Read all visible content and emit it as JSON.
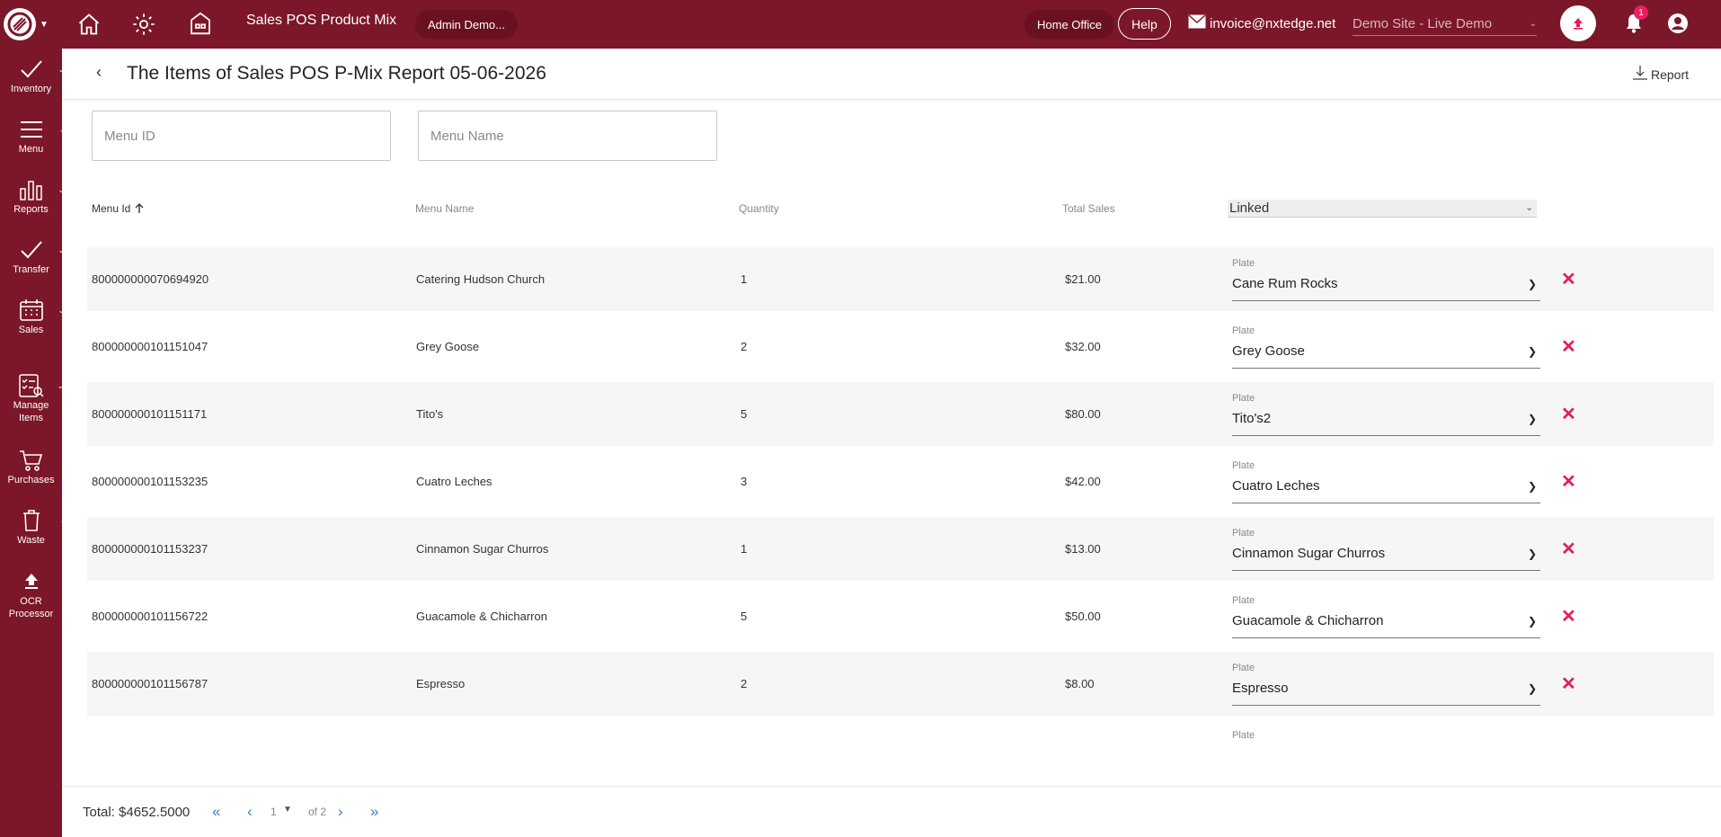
{
  "topbar": {
    "title": "Sales POS Product Mix",
    "user": "Admin Demo...",
    "home_office": "Home Office",
    "help": "Help",
    "email": "invoice@nxtedge.net",
    "site": "Demo Site - Live Demo",
    "notification_count": "1"
  },
  "sidebar": {
    "items": [
      {
        "label": "Inventory",
        "icon": "check-icon"
      },
      {
        "label": "Menu",
        "icon": "menu-icon"
      },
      {
        "label": "Reports",
        "icon": "bar-chart-icon"
      },
      {
        "label": "Transfer",
        "icon": "check-icon"
      },
      {
        "label": "Sales",
        "icon": "calendar-icon"
      },
      {
        "label": "Manage Items",
        "icon": "checklist-icon"
      },
      {
        "label": "Purchases",
        "icon": "cart-icon"
      },
      {
        "label": "Waste",
        "icon": "trash-icon"
      },
      {
        "label": "OCR Processor",
        "icon": "upload-icon"
      }
    ]
  },
  "page": {
    "title": "The Items of Sales POS P-Mix Report 05-06-2026",
    "report_button": "Report"
  },
  "filters": {
    "menu_id_placeholder": "Menu ID",
    "menu_name_placeholder": "Menu Name"
  },
  "table": {
    "headers": {
      "menu_id": "Menu Id",
      "menu_name": "Menu Name",
      "quantity": "Quantity",
      "total_sales": "Total Sales",
      "linked": "Linked"
    },
    "plate_label": "Plate",
    "rows": [
      {
        "id": "800000000070694920",
        "name": "Catering Hudson Church",
        "qty": "1",
        "sales": "$21.00",
        "plate": "Cane Rum Rocks"
      },
      {
        "id": "800000000101151047",
        "name": "Grey Goose",
        "qty": "2",
        "sales": "$32.00",
        "plate": "Grey Goose"
      },
      {
        "id": "800000000101151171",
        "name": "Tito's",
        "qty": "5",
        "sales": "$80.00",
        "plate": "Tito's2"
      },
      {
        "id": "800000000101153235",
        "name": "Cuatro Leches",
        "qty": "3",
        "sales": "$42.00",
        "plate": "Cuatro Leches"
      },
      {
        "id": "800000000101153237",
        "name": "Cinnamon Sugar Churros",
        "qty": "1",
        "sales": "$13.00",
        "plate": "Cinnamon Sugar Churros"
      },
      {
        "id": "800000000101156722",
        "name": "Guacamole & Chicharron",
        "qty": "5",
        "sales": "$50.00",
        "plate": "Guacamole & Chicharron"
      },
      {
        "id": "800000000101156787",
        "name": "Espresso",
        "qty": "2",
        "sales": "$8.00",
        "plate": "Espresso"
      }
    ]
  },
  "footer": {
    "total": "Total: $4652.5000",
    "page": "1",
    "of": "of 2"
  },
  "colors": {
    "brand": "#7b1728",
    "accent_red": "#e01e5a",
    "link_blue": "#3d7bd9"
  }
}
